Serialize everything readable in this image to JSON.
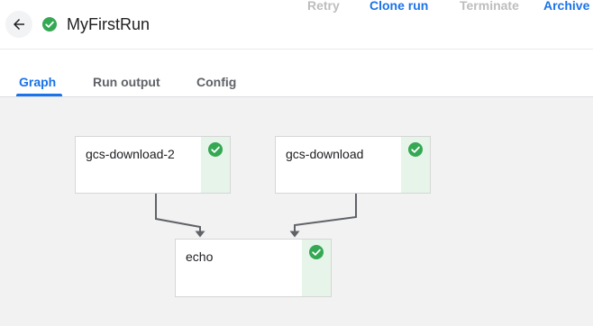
{
  "header": {
    "title": "MyFirstRun",
    "status_icon": "check-circle-icon",
    "back_icon": "arrow-left-icon",
    "actions": {
      "retry": "Retry",
      "clone_run": "Clone run",
      "terminate": "Terminate",
      "archive": "Archive"
    }
  },
  "tabs": [
    {
      "label": "Graph",
      "active": true
    },
    {
      "label": "Run output",
      "active": false
    },
    {
      "label": "Config",
      "active": false
    }
  ],
  "graph": {
    "nodes": [
      {
        "id": "gcs-download-2",
        "label": "gcs-download-2",
        "status": "succeeded"
      },
      {
        "id": "gcs-download",
        "label": "gcs-download",
        "status": "succeeded"
      },
      {
        "id": "echo",
        "label": "echo",
        "status": "succeeded"
      }
    ],
    "edges": [
      {
        "from": "gcs-download-2",
        "to": "echo"
      },
      {
        "from": "gcs-download",
        "to": "echo"
      }
    ]
  },
  "colors": {
    "accent": "#1a73e8",
    "success": "#34a853",
    "success_bg": "#e6f4ea",
    "disabled": "#bdbdbd",
    "canvas_bg": "#f2f2f2",
    "edge": "#5f6368"
  }
}
